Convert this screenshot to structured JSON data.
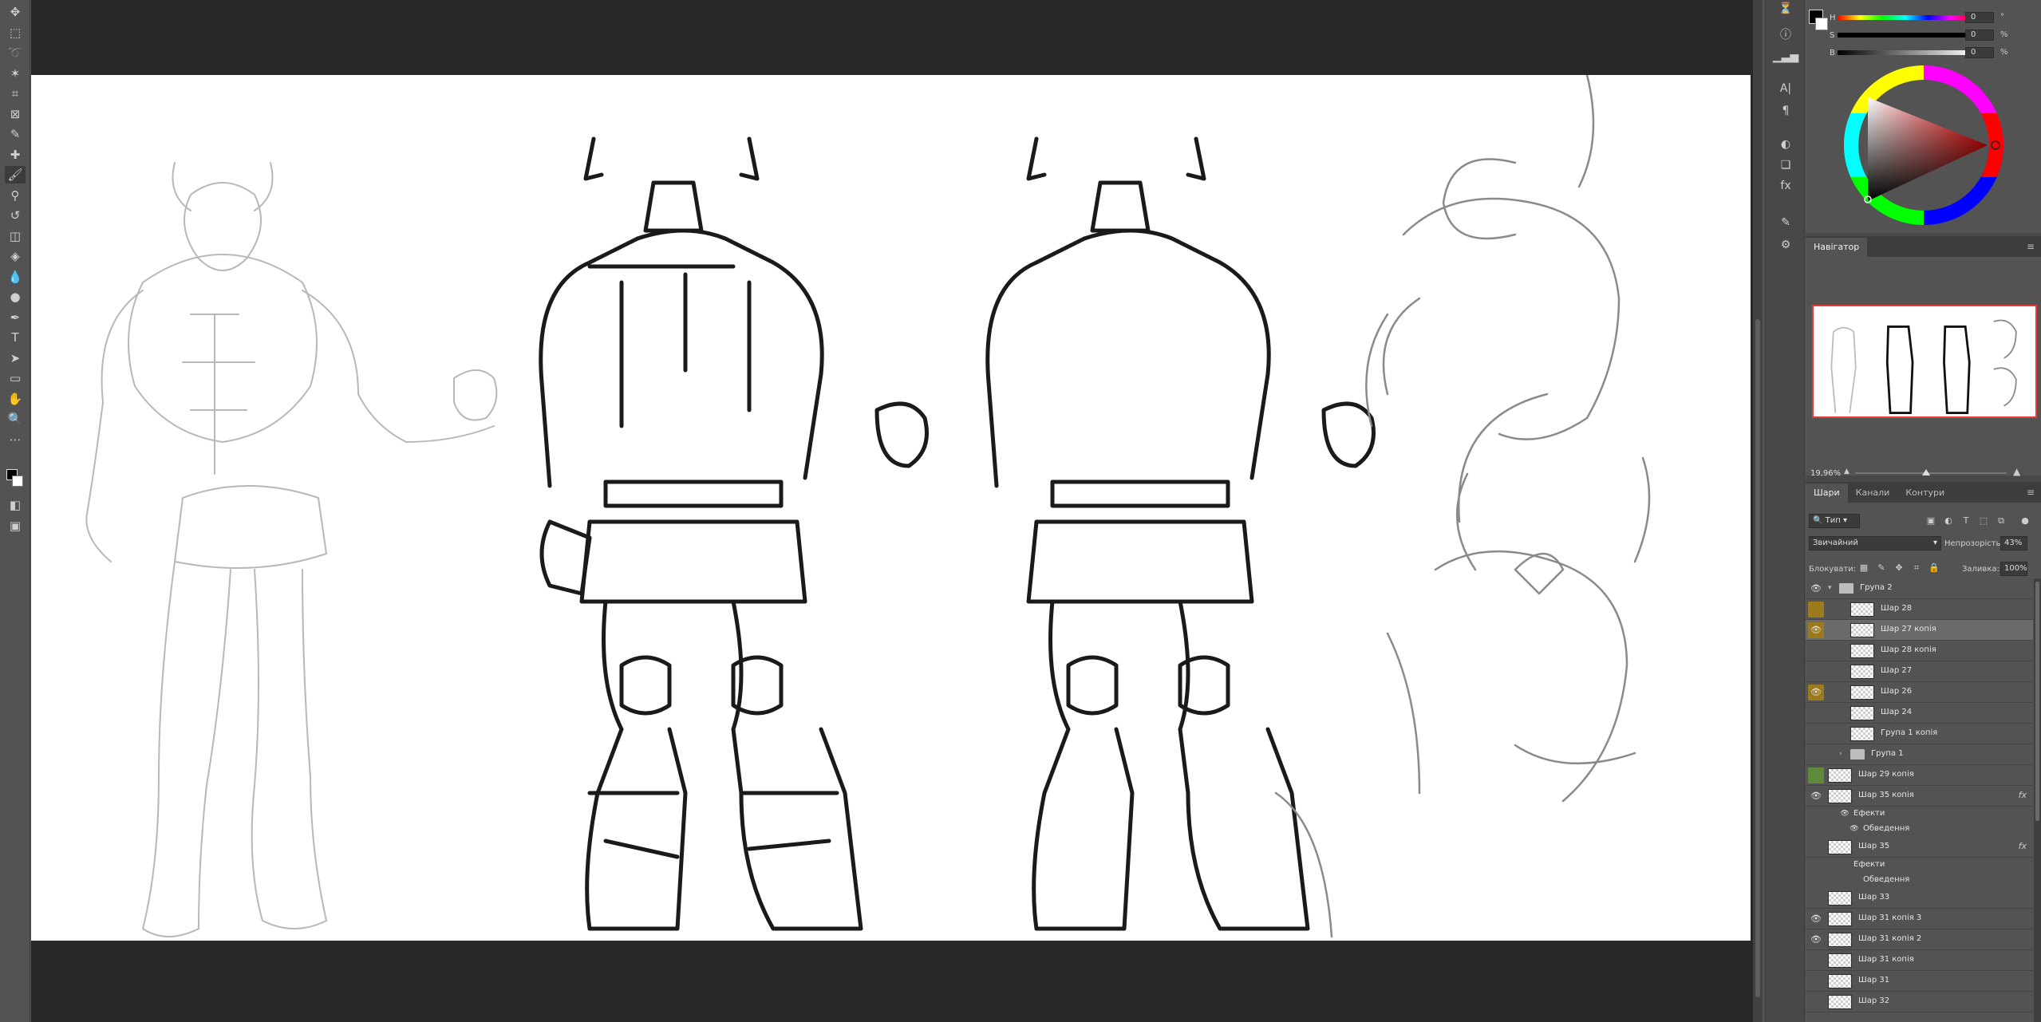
{
  "colors": {
    "ui_bg": "#535353",
    "workspace": "#282828",
    "selected_layer": "#6a6a6a",
    "tag_yellow": "#9a7a1c",
    "tag_green": "#5f8a3a",
    "nav_frame": "#e43b3b"
  },
  "toolbar": {
    "tools": [
      {
        "icon": "move-icon",
        "glyph": "✥"
      },
      {
        "icon": "marquee-icon",
        "glyph": "⬚"
      },
      {
        "icon": "lasso-icon",
        "glyph": "➰"
      },
      {
        "icon": "magic-wand-icon",
        "glyph": "✶"
      },
      {
        "icon": "crop-icon",
        "glyph": "⌗"
      },
      {
        "icon": "frame-icon",
        "glyph": "⊠"
      },
      {
        "icon": "eyedropper-icon",
        "glyph": "✎"
      },
      {
        "icon": "healing-brush-icon",
        "glyph": "✚"
      },
      {
        "icon": "brush-icon",
        "glyph": "🖌"
      },
      {
        "icon": "clone-stamp-icon",
        "glyph": "⚲"
      },
      {
        "icon": "history-brush-icon",
        "glyph": "↺"
      },
      {
        "icon": "eraser-icon",
        "glyph": "◫"
      },
      {
        "icon": "paint-bucket-icon",
        "glyph": "◈"
      },
      {
        "icon": "blur-icon",
        "glyph": "💧"
      },
      {
        "icon": "dodge-icon",
        "glyph": "●"
      },
      {
        "icon": "pen-icon",
        "glyph": "✒"
      },
      {
        "icon": "type-icon",
        "glyph": "T"
      },
      {
        "icon": "path-selection-icon",
        "glyph": "➤"
      },
      {
        "icon": "rectangle-icon",
        "glyph": "▭"
      },
      {
        "icon": "hand-icon",
        "glyph": "✋"
      },
      {
        "icon": "zoom-icon",
        "glyph": "🔍"
      },
      {
        "icon": "more-tools-icon",
        "glyph": "⋯"
      }
    ],
    "bottom_tools": [
      {
        "icon": "quick-mask-icon",
        "glyph": "◧"
      },
      {
        "icon": "screen-mode-icon",
        "glyph": "▣"
      }
    ]
  },
  "iconstrip": [
    {
      "icon": "history-icon",
      "glyph": "⏳"
    },
    {
      "icon": "info-icon",
      "glyph": "ⓘ"
    },
    {
      "icon": "histogram-icon",
      "glyph": "▁▃▅"
    },
    {
      "icon": "character-icon",
      "glyph": "A|"
    },
    {
      "icon": "paragraph-icon",
      "glyph": "¶"
    },
    {
      "icon": "adjustments-icon",
      "glyph": "◐"
    },
    {
      "icon": "libraries-icon",
      "glyph": "❏"
    },
    {
      "icon": "styles-icon",
      "glyph": "fx"
    },
    {
      "icon": "brush-settings-icon",
      "glyph": "✎"
    },
    {
      "icon": "properties-icon",
      "glyph": "⚙"
    }
  ],
  "color_panel": {
    "sliders": [
      {
        "label": "H",
        "value": "0",
        "unit": "°"
      },
      {
        "label": "S",
        "value": "0",
        "unit": "%"
      },
      {
        "label": "B",
        "value": "0",
        "unit": "%"
      }
    ]
  },
  "navigator": {
    "tab": "Навігатор",
    "zoom": "19,96%"
  },
  "layers": {
    "tabs": [
      "Шари",
      "Канали",
      "Контури"
    ],
    "filter_type": "Тип",
    "blend_mode": "Звичайний",
    "opacity_label": "Непрозорість:",
    "opacity_value": "43%",
    "lock_label": "Блокувати:",
    "fill_label": "Заливка:",
    "fill_value": "100%",
    "items": [
      {
        "name": "Група 2",
        "kind": "group",
        "indent": 0,
        "visible": true,
        "tag": "",
        "open": true
      },
      {
        "name": "Шар 28",
        "kind": "layer",
        "indent": 1,
        "visible": false,
        "tag": "yellow"
      },
      {
        "name": "Шар 27 копія",
        "kind": "layer",
        "indent": 1,
        "visible": true,
        "tag": "yellow",
        "selected": true
      },
      {
        "name": "Шар 28 копія",
        "kind": "layer",
        "indent": 1,
        "visible": false,
        "tag": ""
      },
      {
        "name": "Шар 27",
        "kind": "layer",
        "indent": 1,
        "visible": false,
        "tag": ""
      },
      {
        "name": "Шар 26",
        "kind": "layer",
        "indent": 1,
        "visible": true,
        "tag": "yellow"
      },
      {
        "name": "Шар 24",
        "kind": "layer",
        "indent": 1,
        "visible": false,
        "tag": ""
      },
      {
        "name": "Група 1 копія",
        "kind": "layer",
        "indent": 1,
        "visible": false,
        "tag": ""
      },
      {
        "name": "Група 1",
        "kind": "group",
        "indent": 1,
        "visible": false,
        "tag": "",
        "open": false
      },
      {
        "name": "Шар 29 копія",
        "kind": "layer",
        "indent": 0,
        "visible": false,
        "tag": "green"
      },
      {
        "name": "Шар 35 копія",
        "kind": "layer",
        "indent": 0,
        "visible": true,
        "tag": "",
        "fx": "fx"
      },
      {
        "name": "Ефекти",
        "kind": "effect",
        "indent": 0,
        "visible": true,
        "tag": ""
      },
      {
        "name": "Обведення",
        "kind": "effect2",
        "indent": 0,
        "visible": true,
        "tag": ""
      },
      {
        "name": "Шар 35",
        "kind": "layer",
        "indent": 0,
        "visible": false,
        "tag": "",
        "fx": "fx"
      },
      {
        "name": "Ефекти",
        "kind": "effect",
        "indent": 0,
        "visible": false,
        "tag": ""
      },
      {
        "name": "Обведення",
        "kind": "effect2",
        "indent": 0,
        "visible": false,
        "tag": ""
      },
      {
        "name": "Шар 33",
        "kind": "layer",
        "indent": 0,
        "visible": false,
        "tag": ""
      },
      {
        "name": "Шар 31 копія 3",
        "kind": "layer",
        "indent": 0,
        "visible": true,
        "tag": ""
      },
      {
        "name": "Шар 31 копія 2",
        "kind": "layer",
        "indent": 0,
        "visible": true,
        "tag": ""
      },
      {
        "name": "Шар 31 копія",
        "kind": "layer",
        "indent": 0,
        "visible": false,
        "tag": ""
      },
      {
        "name": "Шар 31",
        "kind": "layer",
        "indent": 0,
        "visible": false,
        "tag": ""
      },
      {
        "name": "Шар 32",
        "kind": "layer",
        "indent": 0,
        "visible": false,
        "tag": ""
      }
    ]
  }
}
